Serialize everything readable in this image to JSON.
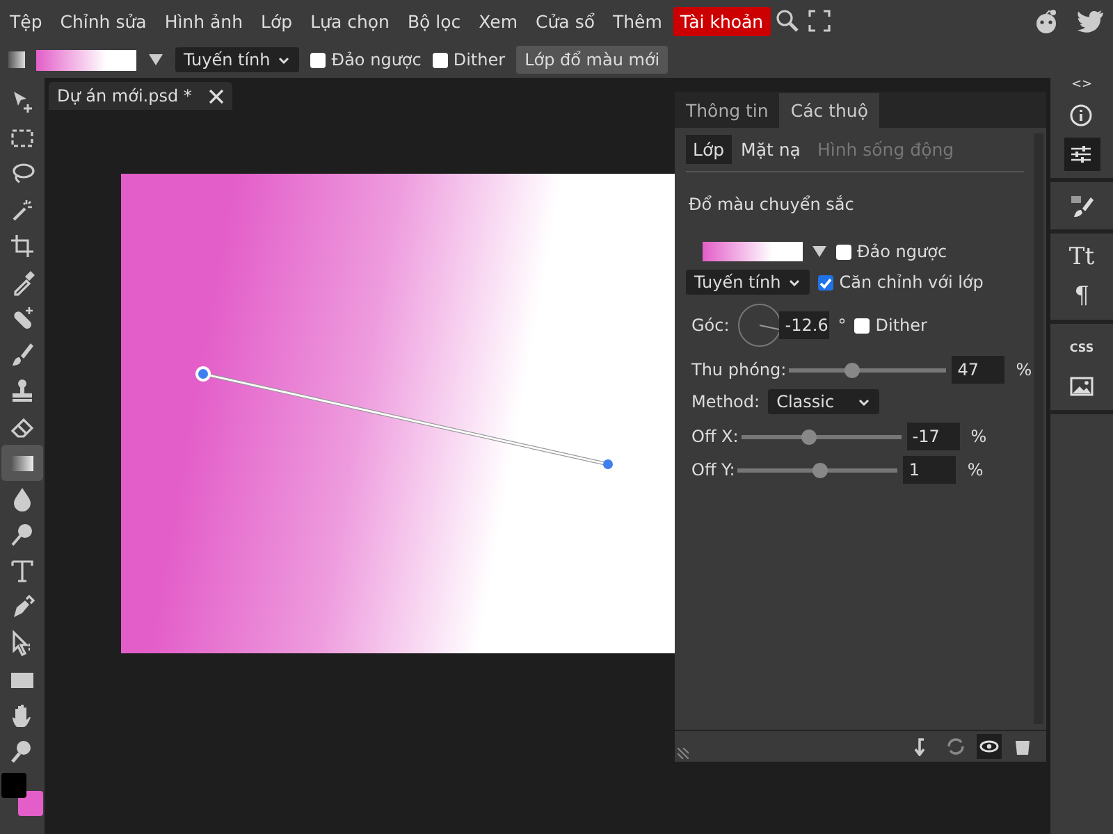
{
  "menu": {
    "items": [
      {
        "label": "Tệp",
        "highlighted": false
      },
      {
        "label": "Chỉnh sửa",
        "highlighted": false
      },
      {
        "label": "Hình ảnh",
        "highlighted": false
      },
      {
        "label": "Lớp",
        "highlighted": false
      },
      {
        "label": "Lựa chọn",
        "highlighted": false
      },
      {
        "label": "Bộ lọc",
        "highlighted": false
      },
      {
        "label": "Xem",
        "highlighted": false
      },
      {
        "label": "Cửa sổ",
        "highlighted": false
      },
      {
        "label": "Thêm",
        "highlighted": false
      },
      {
        "label": "Tài khoản",
        "highlighted": true
      }
    ]
  },
  "options_bar": {
    "type_select": "Tuyến tính",
    "checkboxes": [
      {
        "label": "Đảo ngược",
        "checked": false
      },
      {
        "label": "Dither",
        "checked": false
      }
    ],
    "button": "Lớp đổ màu mới"
  },
  "tools": [
    {
      "kind": "move",
      "selected": false
    },
    {
      "kind": "marquee",
      "selected": false
    },
    {
      "kind": "lasso",
      "selected": false
    },
    {
      "kind": "wand",
      "selected": false
    },
    {
      "kind": "crop",
      "selected": false
    },
    {
      "kind": "eyedropper",
      "selected": false
    },
    {
      "kind": "bandage",
      "selected": false
    },
    {
      "kind": "brush",
      "selected": false
    },
    {
      "kind": "stamp",
      "selected": false
    },
    {
      "kind": "eraser",
      "selected": false
    },
    {
      "kind": "gradient",
      "selected": true
    },
    {
      "kind": "drop",
      "selected": false
    },
    {
      "kind": "dodge",
      "selected": false
    },
    {
      "kind": "type",
      "selected": false
    },
    {
      "kind": "pen",
      "selected": false
    },
    {
      "kind": "pathselect",
      "selected": false
    },
    {
      "kind": "rectangle",
      "selected": false
    },
    {
      "kind": "hand",
      "selected": false
    },
    {
      "kind": "zoom",
      "selected": false
    }
  ],
  "swatches": [
    {
      "kind": "foreground",
      "color": "#000000"
    },
    {
      "kind": "background",
      "color": "#e35ec9"
    }
  ],
  "document_tab": {
    "title": "Dự án mới.psd *"
  },
  "panel": {
    "tabs": [
      {
        "label": "Thông tin",
        "selected": false
      },
      {
        "label": "Các thuộ",
        "selected": true
      }
    ],
    "subtabs": [
      {
        "label": "Lớp",
        "selected": true,
        "disabled": false
      },
      {
        "label": "Mặt nạ",
        "selected": false,
        "disabled": false
      },
      {
        "label": "Hình sống động",
        "selected": false,
        "disabled": true
      }
    ],
    "heading": "Đổ màu chuyển sắc",
    "reverse": {
      "label": "Đảo ngược",
      "checked": false
    },
    "type_select": "Tuyến tính",
    "align": {
      "label": "Căn chỉnh với lớp",
      "checked": true
    },
    "angle": {
      "label": "Góc:",
      "value": "-12.6",
      "unit": "°"
    },
    "dither": {
      "label": "Dither",
      "checked": false
    },
    "sliders": [
      {
        "label": "Thu phóng:",
        "level": 0.4,
        "value": "47",
        "unit": "%"
      }
    ],
    "method": {
      "label": "Method:",
      "value": "Classic"
    },
    "offsets": [
      {
        "label": "Off X:",
        "level": 0.42,
        "value": "-17",
        "unit": "%"
      },
      {
        "label": "Off Y:",
        "level": 0.51,
        "value": "1",
        "unit": "%"
      }
    ]
  },
  "right_strip": {
    "toggle": "<>",
    "groups": [
      [
        {
          "kind": "info",
          "selected": false
        },
        {
          "kind": "sliders",
          "selected": true
        }
      ],
      [
        {
          "kind": "brush",
          "selected": false
        }
      ],
      [
        {
          "kind": "text",
          "label": "Tt",
          "selected": false
        },
        {
          "kind": "text",
          "label": "¶",
          "selected": false
        }
      ],
      [
        {
          "kind": "text",
          "label": "CSS",
          "selected": false
        },
        {
          "kind": "image",
          "selected": false
        }
      ]
    ]
  }
}
